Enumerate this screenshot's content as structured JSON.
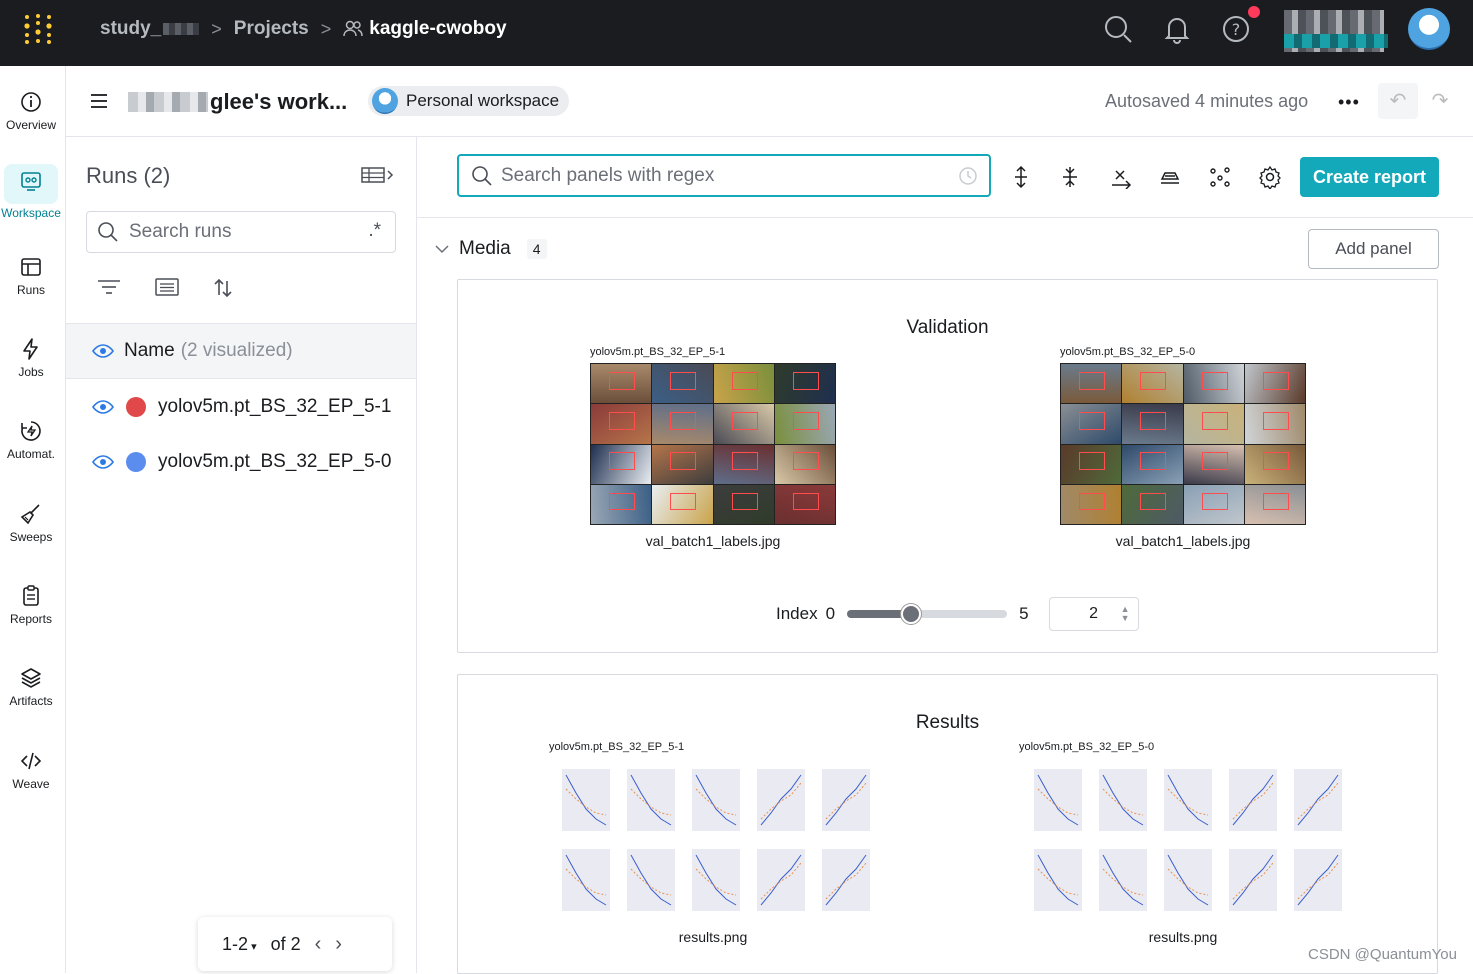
{
  "topbar": {
    "breadcrumb_entity": "study_",
    "breadcrumb_projects": "Projects",
    "breadcrumb_project": "kaggle-cwoboy"
  },
  "leftnav": {
    "items": [
      {
        "label": "Overview",
        "icon": "info-icon"
      },
      {
        "label": "Workspace",
        "icon": "workspace-icon"
      },
      {
        "label": "Runs",
        "icon": "table-icon"
      },
      {
        "label": "Jobs",
        "icon": "lightning-icon"
      },
      {
        "label": "Automat.",
        "icon": "automation-icon"
      },
      {
        "label": "Sweeps",
        "icon": "broom-icon"
      },
      {
        "label": "Reports",
        "icon": "clipboard-icon"
      },
      {
        "label": "Artifacts",
        "icon": "layers-icon"
      },
      {
        "label": "Weave",
        "icon": "code-icon"
      }
    ]
  },
  "header": {
    "workspace_title": "glee's work...",
    "workspace_badge": "Personal workspace",
    "autosave": "Autosaved 4 minutes ago",
    "more": "•••"
  },
  "runs": {
    "title": "Runs (2)",
    "search_placeholder": "Search runs",
    "regex": ".*",
    "name_header": "Name",
    "name_visualized": "(2 visualized)",
    "list": [
      {
        "name": "yolov5m.pt_BS_32_EP_5-1",
        "color": "#e0484a"
      },
      {
        "name": "yolov5m.pt_BS_32_EP_5-0",
        "color": "#5b8def"
      }
    ],
    "pager_range": "1-2",
    "pager_of": "of 2"
  },
  "main": {
    "search_placeholder": "Search panels with regex",
    "create_report": "Create report",
    "section_name": "Media",
    "section_count": "4",
    "add_panel": "Add panel",
    "validation": {
      "title": "Validation",
      "images": [
        {
          "run": "yolov5m.pt_BS_32_EP_5-1",
          "caption": "val_batch1_labels.jpg"
        },
        {
          "run": "yolov5m.pt_BS_32_EP_5-0",
          "caption": "val_batch1_labels.jpg"
        }
      ],
      "index_label": "Index",
      "index_min": "0",
      "index_max": "5",
      "index_value": "2",
      "index_fraction": 0.4
    },
    "results": {
      "title": "Results",
      "images": [
        {
          "run": "yolov5m.pt_BS_32_EP_5-1",
          "caption": "results.png"
        },
        {
          "run": "yolov5m.pt_BS_32_EP_5-0",
          "caption": "results.png"
        }
      ]
    }
  },
  "watermark": "CSDN @QuantumYou",
  "colors": {
    "accent": "#13a9ba",
    "topbar": "#1a1c1f",
    "active_nav": "#038194"
  }
}
